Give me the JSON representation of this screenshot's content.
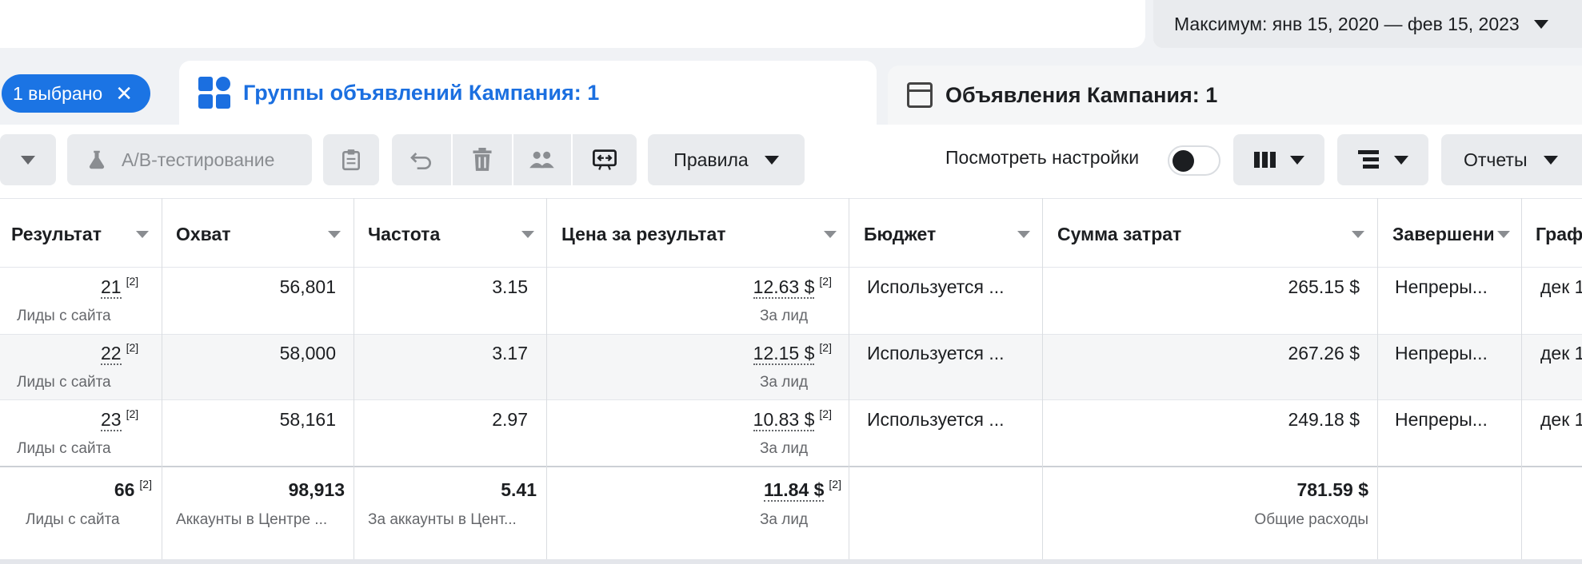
{
  "header": {
    "date_range": "Максимум: янв 15, 2020 — фев 15, 2023"
  },
  "tabs": {
    "selected_chip": "1 выбрано",
    "adsets_tab": "Группы объявлений Кампания: 1",
    "ads_tab": "Объявления Кампания: 1"
  },
  "toolbar": {
    "ab_test": "A/B-тестирование",
    "rules": "Правила",
    "view_settings": "Посмотреть настройки",
    "reports": "Отчеты"
  },
  "table": {
    "columns": [
      "Результат",
      "Охват",
      "Частота",
      "Цена за результат",
      "Бюджет",
      "Сумма затрат",
      "Завершение",
      "Графи"
    ],
    "rows": [
      {
        "result": "21",
        "result_fn": "[2]",
        "result_sub": "Лиды с сайта",
        "reach": "56,801",
        "freq": "3.15",
        "cpr": "12.63 $",
        "cpr_fn": "[2]",
        "cpr_sub": "За лид",
        "budget": "Используется ...",
        "spent": "265.15 $",
        "end": "Непреры...",
        "sched": "дек 1"
      },
      {
        "result": "22",
        "result_fn": "[2]",
        "result_sub": "Лиды с сайта",
        "reach": "58,000",
        "freq": "3.17",
        "cpr": "12.15 $",
        "cpr_fn": "[2]",
        "cpr_sub": "За лид",
        "budget": "Используется ...",
        "spent": "267.26 $",
        "end": "Непреры...",
        "sched": "дек 1"
      },
      {
        "result": "23",
        "result_fn": "[2]",
        "result_sub": "Лиды с сайта",
        "reach": "58,161",
        "freq": "2.97",
        "cpr": "10.83 $",
        "cpr_fn": "[2]",
        "cpr_sub": "За лид",
        "budget": "Используется ...",
        "spent": "249.18 $",
        "end": "Непреры...",
        "sched": "дек 1"
      }
    ],
    "totals": {
      "result": "66",
      "result_fn": "[2]",
      "result_sub": "Лиды с сайта",
      "reach": "98,913",
      "reach_sub": "Аккаунты в Центре ...",
      "freq": "5.41",
      "freq_sub": "За аккаунты в Цент...",
      "cpr": "11.84 $",
      "cpr_fn": "[2]",
      "cpr_sub": "За лид",
      "spent": "781.59 $",
      "spent_sub": "Общие расходы"
    }
  }
}
